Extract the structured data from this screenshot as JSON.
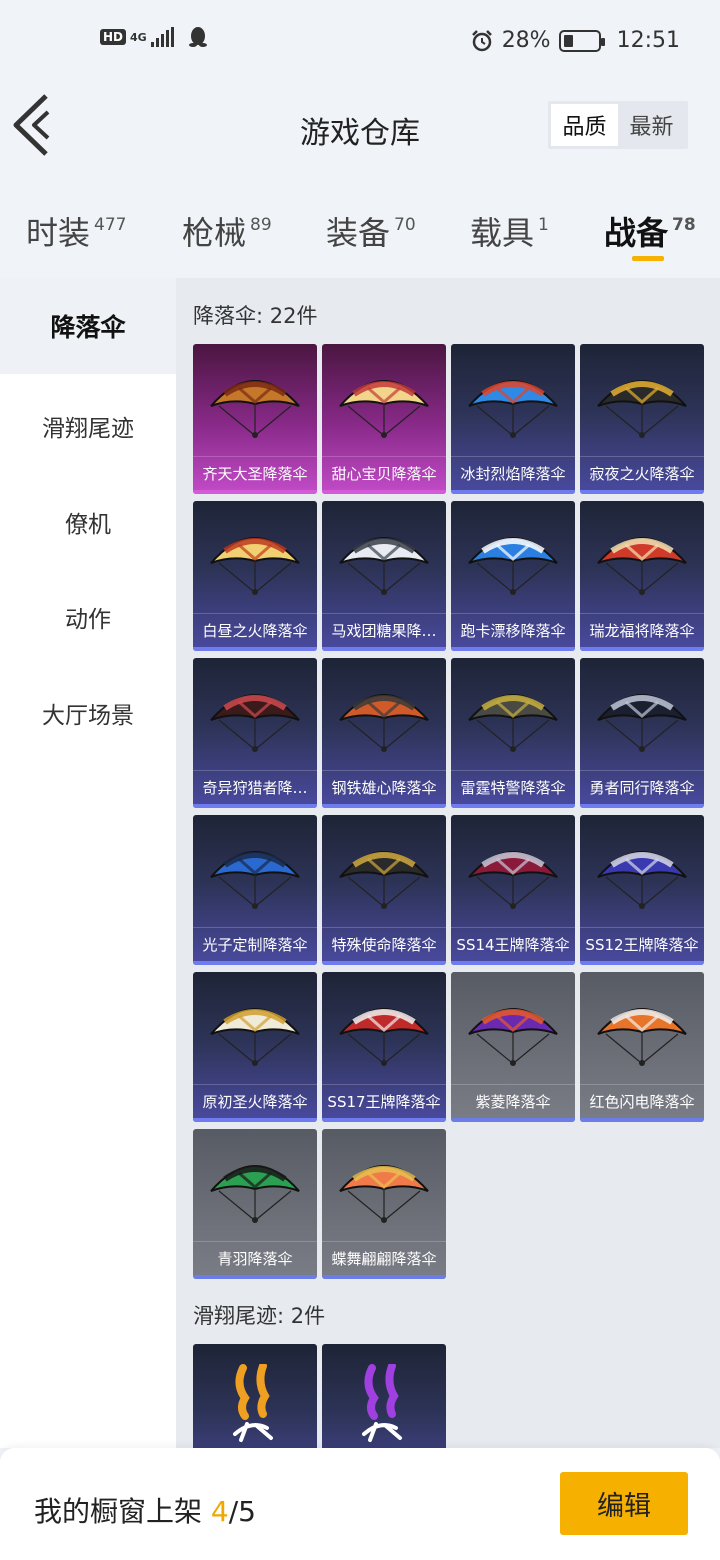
{
  "status_bar": {
    "hd_label": "HD",
    "net_label": "4G",
    "battery_pct": "28%",
    "battery_level": 0.28,
    "time": "12:51",
    "icons": [
      "signal-icon",
      "qq-penguin-icon",
      "alarm-icon",
      "battery-icon"
    ]
  },
  "header": {
    "title": "游戏仓库",
    "sort_options": [
      "品质",
      "最新"
    ],
    "sort_selected": "品质"
  },
  "category_tabs": [
    {
      "label": "时装",
      "count": "477"
    },
    {
      "label": "枪械",
      "count": "89"
    },
    {
      "label": "装备",
      "count": "70"
    },
    {
      "label": "载具",
      "count": "1"
    },
    {
      "label": "战备",
      "count": "78"
    }
  ],
  "active_tab": "战备",
  "sidebar": {
    "items": [
      "降落伞",
      "滑翔尾迹",
      "僚机",
      "动作",
      "大厅场景"
    ],
    "active": "降落伞"
  },
  "sections": [
    {
      "title": "降落伞: 22件",
      "items": [
        {
          "name": "齐天大圣降落伞",
          "rarity": "legendary",
          "colors": [
            "#c5782a",
            "#7a2a14"
          ]
        },
        {
          "name": "甜心宝贝降落伞",
          "rarity": "legendary",
          "colors": [
            "#f2d48a",
            "#c23a3a"
          ]
        },
        {
          "name": "冰封烈焰降落伞",
          "rarity": "epic",
          "colors": [
            "#2e8ae6",
            "#e0452a"
          ]
        },
        {
          "name": "寂夜之火降落伞",
          "rarity": "epic",
          "colors": [
            "#2a2a2a",
            "#e6b030"
          ]
        },
        {
          "name": "白昼之火降落伞",
          "rarity": "epic",
          "colors": [
            "#f0d070",
            "#c03a20"
          ]
        },
        {
          "name": "马戏团糖果降…",
          "rarity": "epic",
          "colors": [
            "#e8ecf2",
            "#3a3e4a"
          ]
        },
        {
          "name": "跑卡漂移降落伞",
          "rarity": "epic",
          "colors": [
            "#2a7fe0",
            "#ffffff"
          ]
        },
        {
          "name": "瑞龙福将降落伞",
          "rarity": "epic",
          "colors": [
            "#d03a2a",
            "#f2e2b0"
          ]
        },
        {
          "name": "奇异狩猎者降…",
          "rarity": "epic",
          "colors": [
            "#3a1a1a",
            "#d04a50"
          ]
        },
        {
          "name": "钢铁雄心降落伞",
          "rarity": "epic",
          "colors": [
            "#d05a2a",
            "#3a3a3a"
          ]
        },
        {
          "name": "雷霆特警降落伞",
          "rarity": "epic",
          "colors": [
            "#4a4a44",
            "#c8b040"
          ]
        },
        {
          "name": "勇者同行降落伞",
          "rarity": "epic",
          "colors": [
            "#1a2030",
            "#c0c8d8"
          ]
        },
        {
          "name": "光子定制降落伞",
          "rarity": "epic",
          "colors": [
            "#2a6ad0",
            "#1a2a4a"
          ]
        },
        {
          "name": "特殊使命降落伞",
          "rarity": "epic",
          "colors": [
            "#2a2a2a",
            "#d0a840"
          ]
        },
        {
          "name": "SS14王牌降落伞",
          "rarity": "epic",
          "colors": [
            "#8a1a3a",
            "#c8c8d8"
          ]
        },
        {
          "name": "SS12王牌降落伞",
          "rarity": "epic",
          "colors": [
            "#3a3ab0",
            "#d8d8e8"
          ]
        },
        {
          "name": "原初圣火降落伞",
          "rarity": "epic",
          "colors": [
            "#f0ead8",
            "#d0a030"
          ]
        },
        {
          "name": "SS17王牌降落伞",
          "rarity": "epic",
          "colors": [
            "#c02a2a",
            "#f0f0f0"
          ]
        },
        {
          "name": "紫菱降落伞",
          "rarity": "rare",
          "colors": [
            "#6a2ab0",
            "#e85a2a"
          ]
        },
        {
          "name": "红色闪电降落伞",
          "rarity": "rare",
          "colors": [
            "#e8742a",
            "#f0f0f0"
          ]
        },
        {
          "name": "青羽降落伞",
          "rarity": "rare",
          "colors": [
            "#2aa050",
            "#1a1a1a"
          ]
        },
        {
          "name": "蝶舞翩翩降落伞",
          "rarity": "rare",
          "colors": [
            "#f07a4a",
            "#e8c050"
          ]
        }
      ]
    },
    {
      "title": "滑翔尾迹: 2件",
      "items": [
        {
          "name": "",
          "rarity": "epic",
          "colors": [
            "#f0a020",
            "#ffffff"
          ]
        },
        {
          "name": "",
          "rarity": "epic",
          "colors": [
            "#a040e0",
            "#ffffff"
          ]
        }
      ]
    }
  ],
  "bottom": {
    "showcase_label": "我的橱窗上架",
    "showcase_count": "4",
    "showcase_total": "/5",
    "edit_label": "编辑"
  },
  "accent_color": "#f6b000"
}
